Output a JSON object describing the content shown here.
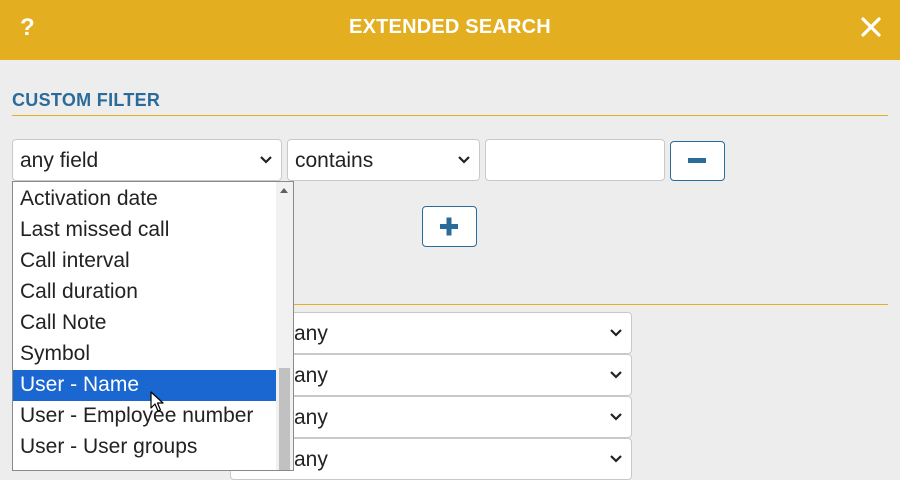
{
  "dialog": {
    "title": "EXTENDED SEARCH",
    "help_label": "?",
    "section_title": "CUSTOM FILTER"
  },
  "filter_row": {
    "field_value": "any field",
    "operator_value": "contains",
    "text_value": ""
  },
  "dropdown": {
    "items": [
      "Activation date",
      "Last missed call",
      "Call interval",
      "Call duration",
      "Call Note",
      "Symbol",
      "User - Name",
      "User - Employee number",
      "User - User groups"
    ],
    "selected_index": 6
  },
  "lower_selects": [
    "any",
    "any",
    "any",
    "any"
  ],
  "colors": {
    "header": "#e3ae1f",
    "accent": "#2a6b9a",
    "selection": "#1a67d2",
    "background": "#ededed"
  },
  "icons": {
    "help": "question-mark-icon",
    "close": "close-icon",
    "remove": "minus-icon",
    "add": "plus-icon",
    "dropdown": "chevron-down-icon"
  }
}
